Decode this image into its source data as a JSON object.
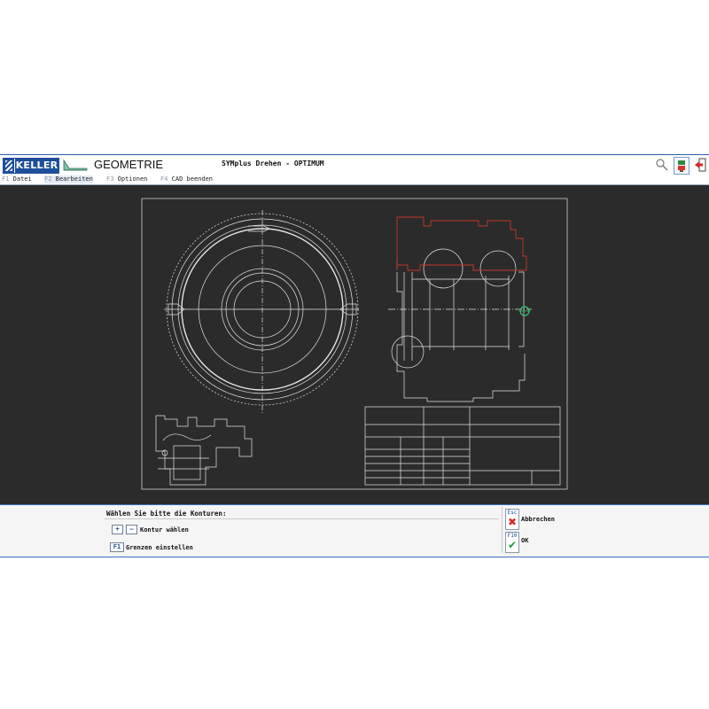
{
  "titlebar": {
    "logo_text": "KELLER",
    "module_title": "GEOMETRIE",
    "app_title": "SYMplus Drehen - OPTIMUM"
  },
  "icons": {
    "search": "search-icon",
    "plugin": "plugin-icon",
    "exit": "exit-icon",
    "cancel": "cross-icon",
    "ok": "checkmark-icon"
  },
  "menu": [
    {
      "key": "F1",
      "label": "Datei"
    },
    {
      "key": "F2",
      "label": "Bearbeiten"
    },
    {
      "key": "F3",
      "label": "Optionen"
    },
    {
      "key": "F4",
      "label": "CAD beenden"
    }
  ],
  "panel": {
    "prompt": "Wählen Sie bitte die Konturen:",
    "plus_key": "+",
    "minus_key": "–",
    "contour_label": "Kontur wählen",
    "f1_key": "F1",
    "limits_label": "Grenzen einstellen",
    "esc_key": "Esc",
    "cancel_label": "Abbrechen",
    "f10_key": "F10",
    "ok_label": "OK"
  },
  "colors": {
    "accent": "#1e4f9a",
    "canvas": "#2b2b2b",
    "drawing": "#e8e8e8",
    "contour": "#c0392b",
    "selection": "#2ecc71",
    "cancel": "#d62b2b",
    "ok": "#1a9c3a"
  }
}
